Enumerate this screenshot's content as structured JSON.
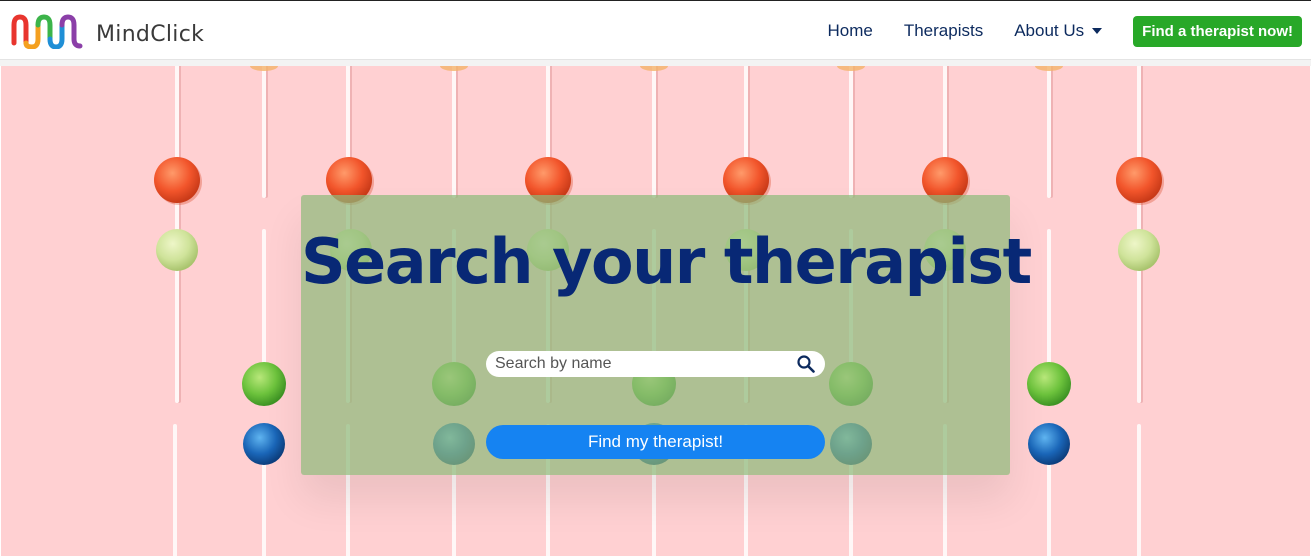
{
  "brand": {
    "name": "MindClick",
    "logo_icon": "rainbow-wave-logo"
  },
  "nav": {
    "items": [
      {
        "label": "Home"
      },
      {
        "label": "Therapists"
      },
      {
        "label": "About Us",
        "has_dropdown": true
      }
    ],
    "cta_label": "Find a therapist now!"
  },
  "hero": {
    "background": "lollipops-on-pink",
    "title": "Search your therapist",
    "search": {
      "placeholder": "Search by name",
      "value": "",
      "icon": "search-icon"
    },
    "submit_label": "Find my therapist!"
  },
  "colors": {
    "brand_text": "#3a3a3a",
    "nav_text": "#0c2a5e",
    "cta_green": "#28a828",
    "hero_pink": "#ffd0d2",
    "card_green": "#8fba7a",
    "title_navy": "#082875",
    "button_blue": "#1583f2"
  }
}
